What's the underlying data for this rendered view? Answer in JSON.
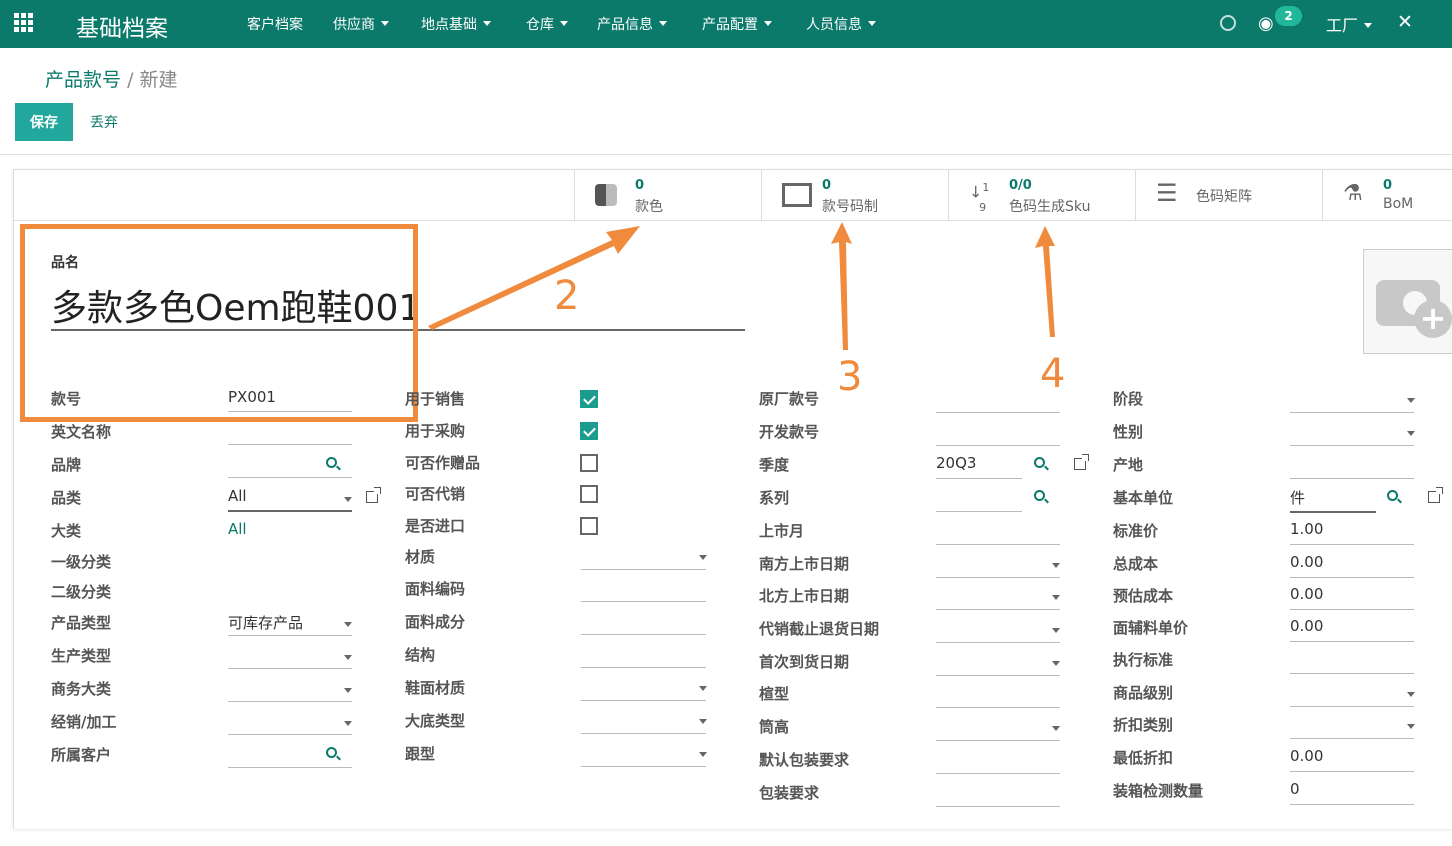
{
  "app": {
    "title": "基础档案"
  },
  "nav": [
    "客户档案",
    "供应商",
    "地点基础",
    "仓库",
    "产品信息",
    "产品配置",
    "人员信息"
  ],
  "topright": {
    "badge": "2",
    "user": "工厂"
  },
  "breadcrumb": {
    "parent": "产品款号",
    "separator": "/",
    "current": "新建"
  },
  "toolbar": {
    "save": "保存",
    "discard": "丢弃"
  },
  "smart_buttons": [
    {
      "num": "0",
      "label": "款色",
      "icon": "checkerboard-icon"
    },
    {
      "num": "0",
      "label": "款号码制",
      "icon": "barcode-frame-icon"
    },
    {
      "num": "0/0",
      "label": "色码生成Sku",
      "icon": "sort-numeric-icon"
    },
    {
      "num": "",
      "label": "色码矩阵",
      "icon": "list-icon"
    },
    {
      "num": "0",
      "label": "BoM",
      "icon": "flask-icon"
    }
  ],
  "product": {
    "name_label": "品名",
    "name": "多款多色Oem跑鞋001"
  },
  "col1": [
    {
      "label": "款号",
      "value": "PX001"
    },
    {
      "label": "英文名称",
      "value": ""
    },
    {
      "label": "品牌",
      "value": ""
    },
    {
      "label": "品类",
      "value": "All"
    },
    {
      "label": "大类",
      "value": "All"
    },
    {
      "label": "一级分类",
      "value": ""
    },
    {
      "label": "二级分类",
      "value": ""
    },
    {
      "label": "产品类型",
      "value": "可库存产品"
    },
    {
      "label": "生产类型",
      "value": ""
    },
    {
      "label": "商务大类",
      "value": ""
    },
    {
      "label": "经销/加工",
      "value": ""
    },
    {
      "label": "所属客户",
      "value": ""
    }
  ],
  "col2": [
    {
      "label": "用于销售",
      "checked": true
    },
    {
      "label": "用于采购",
      "checked": true
    },
    {
      "label": "可否作赠品",
      "checked": false
    },
    {
      "label": "可否代销",
      "checked": false
    },
    {
      "label": "是否进口",
      "checked": false
    },
    {
      "label": "材质"
    },
    {
      "label": "面料编码"
    },
    {
      "label": "面料成分"
    },
    {
      "label": "结构"
    },
    {
      "label": "鞋面材质"
    },
    {
      "label": "大底类型"
    },
    {
      "label": "跟型"
    }
  ],
  "col3": [
    {
      "label": "原厂款号",
      "value": ""
    },
    {
      "label": "开发款号",
      "value": ""
    },
    {
      "label": "季度",
      "value": "20Q3"
    },
    {
      "label": "系列",
      "value": ""
    },
    {
      "label": "上市月",
      "value": ""
    },
    {
      "label": "南方上市日期",
      "value": ""
    },
    {
      "label": "北方上市日期",
      "value": ""
    },
    {
      "label": "代销截止退货日期",
      "value": ""
    },
    {
      "label": "首次到货日期",
      "value": ""
    },
    {
      "label": "楦型",
      "value": ""
    },
    {
      "label": "筒高",
      "value": ""
    },
    {
      "label": "默认包装要求",
      "value": ""
    },
    {
      "label": "包装要求",
      "value": ""
    }
  ],
  "col4": [
    {
      "label": "阶段",
      "value": ""
    },
    {
      "label": "性别",
      "value": ""
    },
    {
      "label": "产地",
      "value": ""
    },
    {
      "label": "基本单位",
      "value": "件"
    },
    {
      "label": "标准价",
      "value": "1.00"
    },
    {
      "label": "总成本",
      "value": "0.00"
    },
    {
      "label": "预估成本",
      "value": "0.00"
    },
    {
      "label": "面辅料单价",
      "value": "0.00"
    },
    {
      "label": "执行标准",
      "value": ""
    },
    {
      "label": "商品级别",
      "value": ""
    },
    {
      "label": "折扣类别",
      "value": ""
    },
    {
      "label": "最低折扣",
      "value": "0.00"
    },
    {
      "label": "装箱检测数量",
      "value": "0"
    }
  ],
  "annotations": [
    "2",
    "3",
    "4"
  ],
  "colors": {
    "primary": "#0b7a6b",
    "accent": "#21a79b",
    "annotation": "#f08a3c"
  }
}
